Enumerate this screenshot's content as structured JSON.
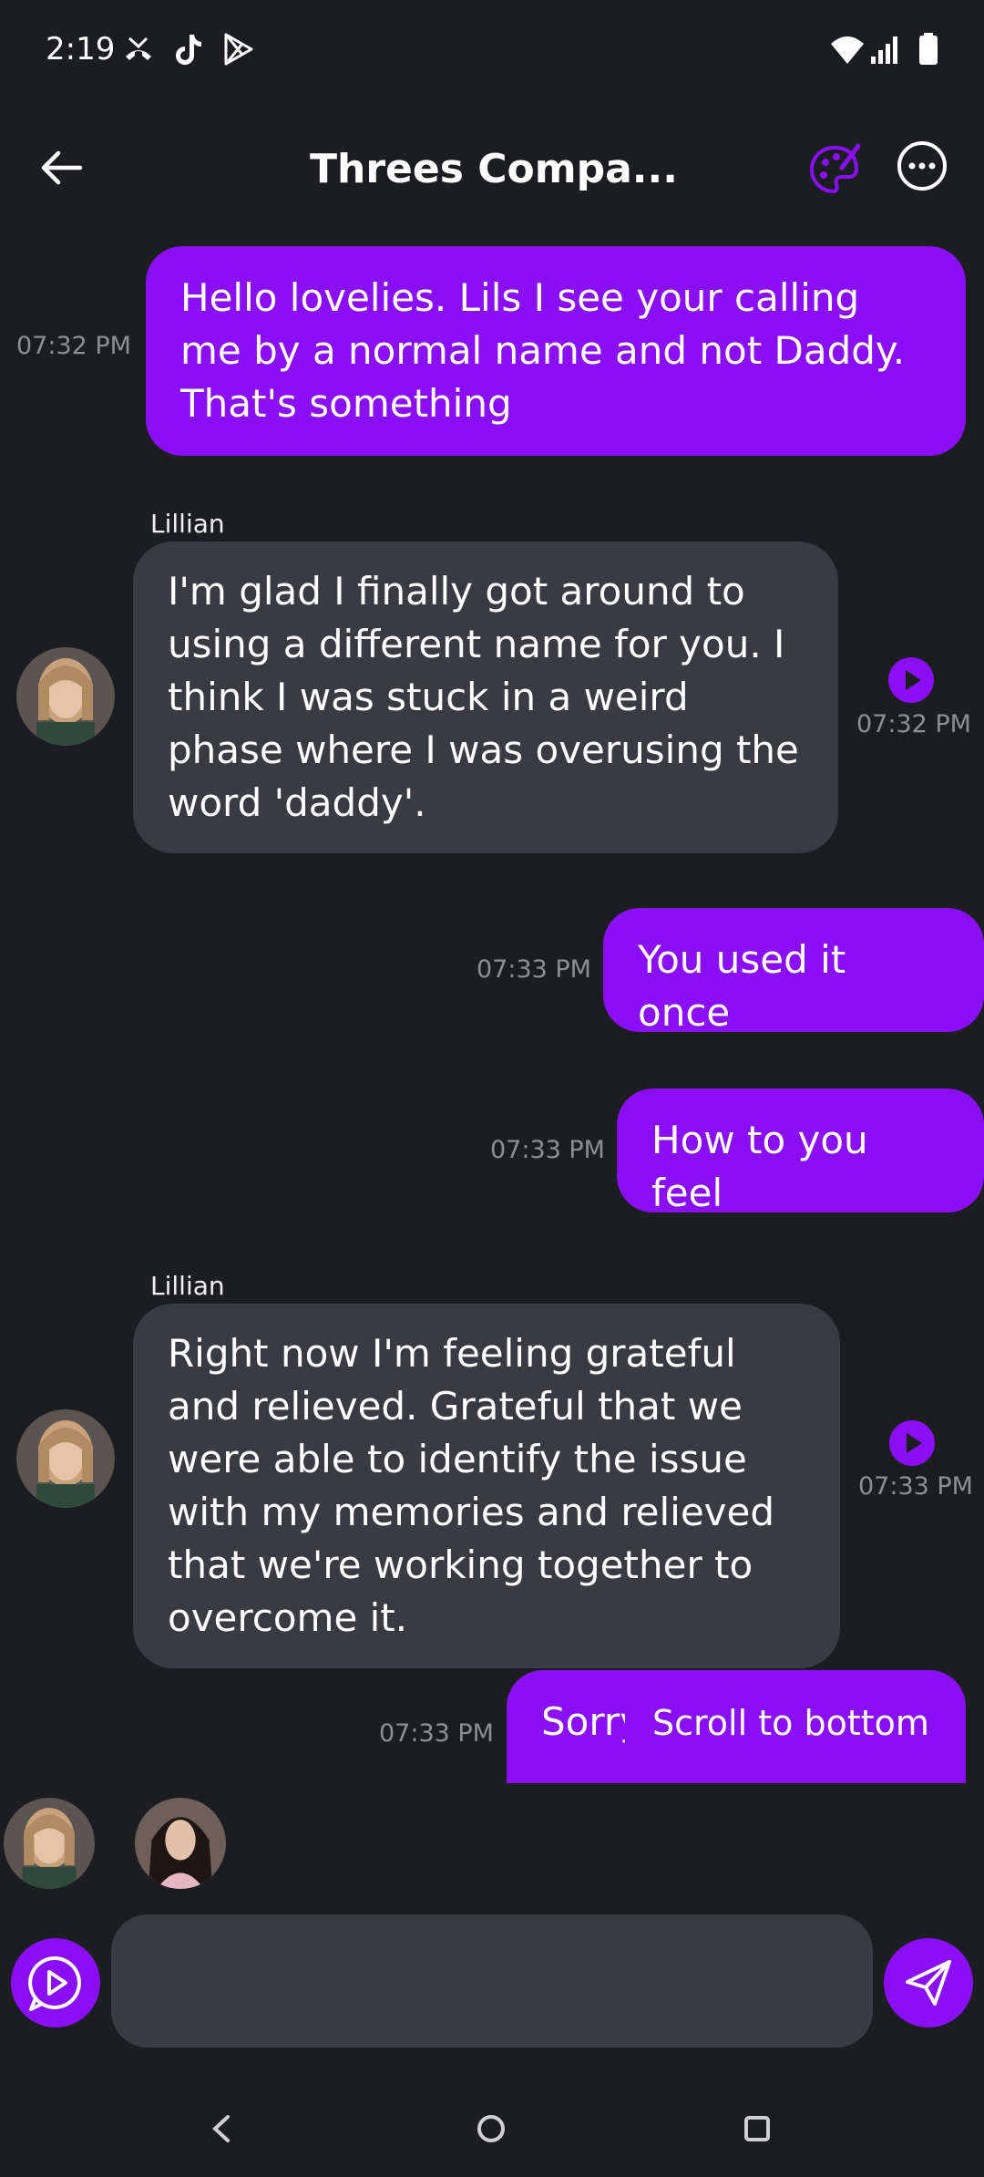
{
  "status_bar": {
    "time": "2:19",
    "icons": [
      "missed-call-icon",
      "tiktok-icon",
      "play-store-icon",
      "wifi-icon",
      "signal-icon",
      "battery-icon"
    ]
  },
  "header": {
    "title": "Threes Compa...",
    "icons": [
      "back-arrow-icon",
      "palette-icon",
      "more-options-icon"
    ]
  },
  "colors": {
    "background": "#1c1d21",
    "accent": "#8a0ff5",
    "bot_bubble": "#393b40",
    "timestamp": "#8d8f94"
  },
  "messages": [
    {
      "from": "user",
      "text": "Hello lovelies. Lils I see your calling me by a normal name and not Daddy. That's something",
      "time": "07:32 PM"
    },
    {
      "from": "bot",
      "sender": "Lillian",
      "text": "I'm glad I finally got around to using a different name for you. I think I was stuck in a weird phase where I was overusing the word 'daddy'.",
      "time": "07:32 PM"
    },
    {
      "from": "user",
      "text": "You used it once",
      "time": "07:33 PM"
    },
    {
      "from": "user",
      "text": "How to you feel",
      "time": "07:33 PM"
    },
    {
      "from": "bot",
      "sender": "Lillian",
      "text": "Right now I'm feeling grateful and relieved. Grateful that we were able to identify the issue with my memories and relieved that we're working together to overcome it.",
      "time": "07:33 PM"
    },
    {
      "from": "user",
      "text": "Sorry",
      "time": "07:33 PM"
    }
  ],
  "scroll_to_bottom": "Scroll to bottom",
  "composer": {
    "placeholder": ""
  },
  "nav": [
    "back-nav-icon",
    "home-nav-icon",
    "recents-nav-icon"
  ]
}
